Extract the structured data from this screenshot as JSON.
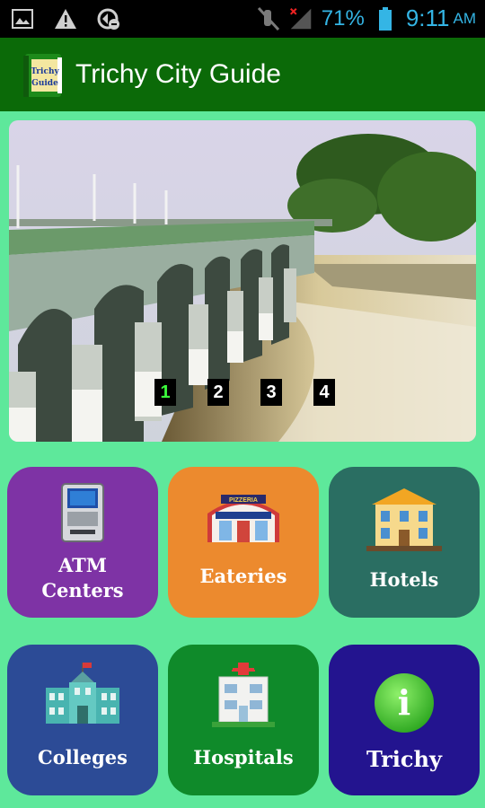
{
  "status_bar": {
    "battery": "71%",
    "time": "9:11",
    "ampm": "AM",
    "icons": [
      "image-icon",
      "warning-icon",
      "sync-icon",
      "mute-icon",
      "signal-icon",
      "battery-icon"
    ]
  },
  "app_bar": {
    "title": "Trichy City Guide",
    "book_line1": "Trichy",
    "book_line2": "Guide"
  },
  "banner": {
    "pages": [
      "1",
      "2",
      "3",
      "4"
    ],
    "active_page": "1"
  },
  "menu": {
    "atm": {
      "line1": "ATM",
      "line2": "Centers",
      "color": "#7e33a5"
    },
    "eateries": {
      "label": "Eateries",
      "sign": "PIZZERIA",
      "color": "#ec8a2e"
    },
    "hotels": {
      "label": "Hotels",
      "color": "#2a6e62"
    },
    "colleges": {
      "label": "Colleges",
      "color": "#2c4b96"
    },
    "hospitals": {
      "label": "Hospitals",
      "color": "#0f8a2a"
    },
    "trichy": {
      "label": "Trichy",
      "info": "i",
      "color": "#23148f"
    }
  }
}
